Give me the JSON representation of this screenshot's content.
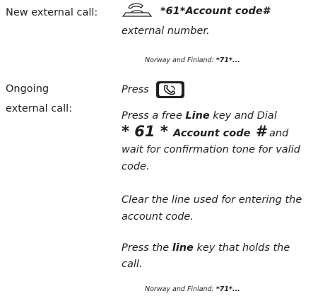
{
  "section1": {
    "label": "New external call:",
    "code": "*61*Account code#",
    "line2": "external number.",
    "note_prefix": "Norway and Finland: ",
    "note_code": "*71*..."
  },
  "section2": {
    "label_line1": "Ongoing",
    "label_line2": "external call:",
    "press": "Press",
    "p1_a": "Press a free ",
    "p1_line": "Line",
    "p1_b": " key and Dial",
    "dial_star1": "* 61 * ",
    "dial_account": "Account code",
    "dial_hash": " #",
    "dial_and": " and",
    "p1_c": "wait for confirmation tone for valid",
    "p1_d": "code.",
    "p2_a": "Clear the line used for entering the",
    "p2_b": "account code.",
    "p3_a": "Press the ",
    "p3_line": "line",
    "p3_b": " key that holds the",
    "p3_c": "call.",
    "note_prefix": "Norway and Finland: ",
    "note_code": "*71*..."
  },
  "icons": {
    "handset": "offhook-handset-icon",
    "key": "phone-key-icon"
  }
}
